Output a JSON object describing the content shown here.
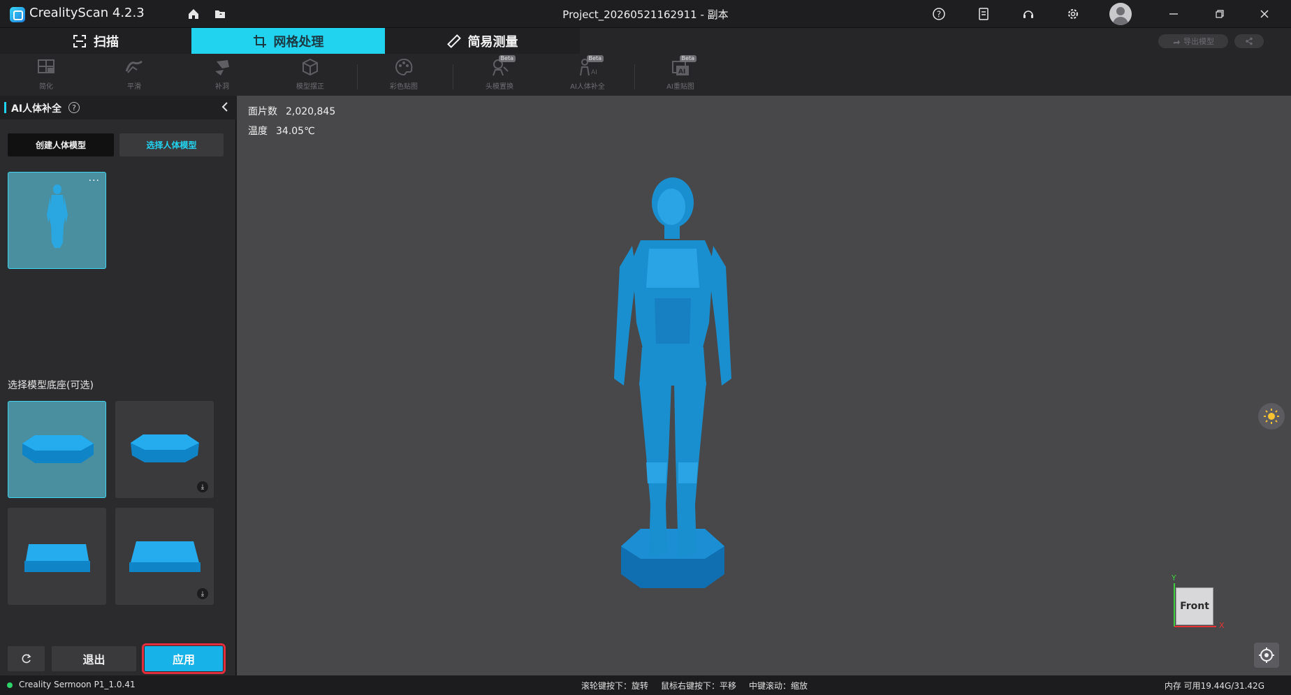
{
  "app": {
    "title": "CrealityScan 4.2.3",
    "project_title": "Project_20260521162911 - 副本"
  },
  "main_tabs": [
    {
      "label": "扫描",
      "icon": "scan-frame-icon"
    },
    {
      "label": "网格处理",
      "icon": "crop-icon",
      "active": true
    },
    {
      "label": "简易测量",
      "icon": "ruler-icon"
    }
  ],
  "header_actions": {
    "export_label": "导出模型"
  },
  "toolbar": {
    "tools": [
      {
        "label": "简化",
        "icon": "simplify-icon"
      },
      {
        "label": "平滑",
        "icon": "smooth-icon"
      },
      {
        "label": "补洞",
        "icon": "fill-hole-icon"
      },
      {
        "label": "模型摆正",
        "icon": "align-model-icon"
      },
      {
        "label": "彩色贴图",
        "icon": "palette-icon"
      },
      {
        "label": "头模置换",
        "icon": "head-replace-icon",
        "badge": "Beta"
      },
      {
        "label": "AI人体补全",
        "icon": "ai-body-icon",
        "badge": "Beta"
      },
      {
        "label": "AI重贴图",
        "icon": "ai-texture-icon",
        "badge": "Beta"
      }
    ]
  },
  "left_panel": {
    "title": "AI人体补全",
    "create_label": "创建人体模型",
    "select_label": "选择人体模型",
    "base_section_label": "选择模型底座(可选)",
    "more_label": "···",
    "reset_label": "C",
    "exit_label": "退出",
    "apply_label": "应用"
  },
  "viewport": {
    "faces_label": "面片数",
    "faces_value": "2,020,845",
    "temp_label": "温度",
    "temp_value": "34.05℃",
    "view_cube_label": "Front",
    "axis_x": "X",
    "axis_y": "Y",
    "model_color": "#1a8fd0"
  },
  "status_bar": {
    "device": "Creality Sermoon P1_1.0.41",
    "hint_rotate": "滚轮键按下：旋转",
    "hint_pan": "鼠标右键按下：平移",
    "hint_zoom": "中键滚动：缩放",
    "memory": "内存 可用19.44G/31.42G",
    "status_color": "#2fd36b"
  }
}
